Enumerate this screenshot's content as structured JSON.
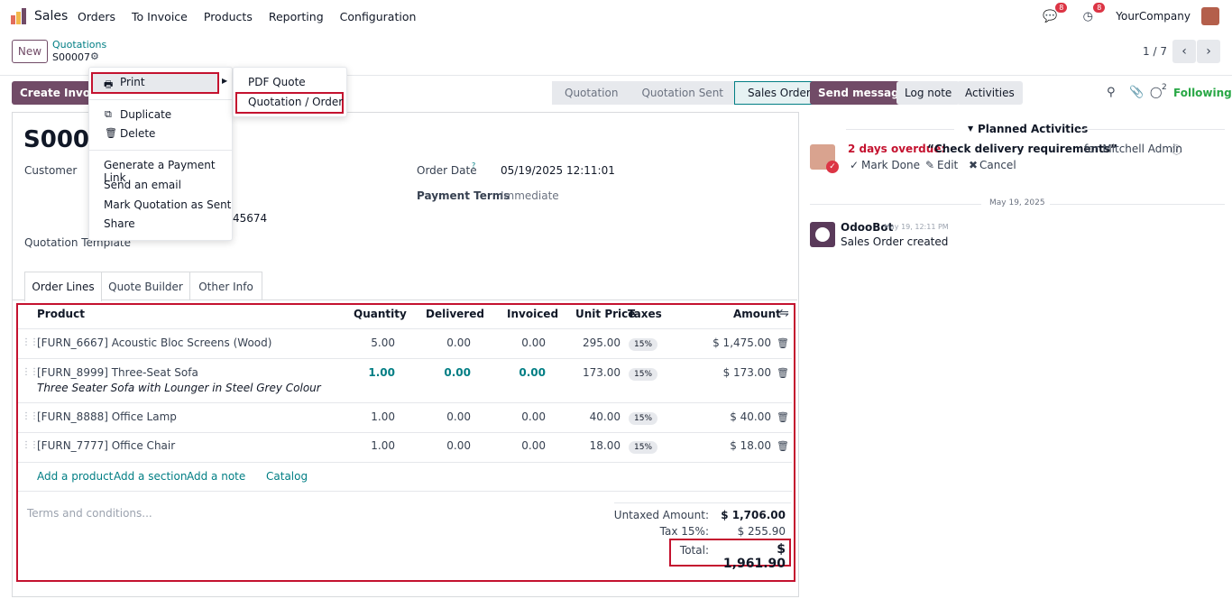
{
  "app": {
    "name": "Sales",
    "menu": [
      "Orders",
      "To Invoice",
      "Products",
      "Reporting",
      "Configuration"
    ],
    "company": "YourCompany",
    "messages_badge": "8",
    "activities_badge": "8"
  },
  "breadcrumb": {
    "new_label": "New",
    "parent": "Quotations",
    "record": "S00007",
    "pager": "1 / 7"
  },
  "actions": {
    "create_invoice": "Create Invoice"
  },
  "statusbar": [
    "Quotation",
    "Quotation Sent",
    "Sales Order"
  ],
  "form": {
    "title": "S0000",
    "customer_label": "Customer",
    "phone_fragment": "45674",
    "quotation_template_label": "Quotation Template",
    "order_date_label": "Order Date",
    "order_date_help": "?",
    "order_date": "05/19/2025 12:11:01",
    "payment_terms_label": "Payment Terms",
    "payment_terms": "Immediate"
  },
  "tabs": [
    "Order Lines",
    "Quote Builder",
    "Other Info"
  ],
  "table": {
    "headers": {
      "product": "Product",
      "quantity": "Quantity",
      "delivered": "Delivered",
      "invoiced": "Invoiced",
      "unit_price": "Unit Price",
      "taxes": "Taxes",
      "amount": "Amount"
    },
    "rows": [
      {
        "product": "[FURN_6667] Acoustic Bloc Screens (Wood)",
        "desc": "",
        "qty": "5.00",
        "delivered": "0.00",
        "invoiced": "0.00",
        "price": "295.00",
        "tax": "15%",
        "amount": "$ 1,475.00"
      },
      {
        "product": "[FURN_8999] Three-Seat Sofa",
        "desc": "Three Seater Sofa with Lounger in Steel Grey Colour",
        "qty": "1.00",
        "delivered": "0.00",
        "invoiced": "0.00",
        "price": "173.00",
        "tax": "15%",
        "amount": "$ 173.00"
      },
      {
        "product": "[FURN_8888] Office Lamp",
        "desc": "",
        "qty": "1.00",
        "delivered": "0.00",
        "invoiced": "0.00",
        "price": "40.00",
        "tax": "15%",
        "amount": "$ 40.00"
      },
      {
        "product": "[FURN_7777] Office Chair",
        "desc": "",
        "qty": "1.00",
        "delivered": "0.00",
        "invoiced": "0.00",
        "price": "18.00",
        "tax": "15%",
        "amount": "$ 18.00"
      }
    ],
    "add_links": [
      "Add a product",
      "Add a section",
      "Add a note",
      "Catalog"
    ]
  },
  "totals": {
    "terms_placeholder": "Terms and conditions...",
    "untaxed_label": "Untaxed Amount:",
    "untaxed": "$ 1,706.00",
    "tax_label": "Tax 15%:",
    "tax": "$ 255.90",
    "total_label": "Total:",
    "total": "$ 1,961.90"
  },
  "gear_menu": {
    "print": "Print",
    "duplicate": "Duplicate",
    "delete": "Delete",
    "payment_link": "Generate a Payment Link",
    "send_email": "Send an email",
    "mark_sent": "Mark Quotation as Sent",
    "share": "Share"
  },
  "print_submenu": [
    "PDF Quote",
    "Quotation / Order"
  ],
  "chatter": {
    "send_message": "Send message",
    "log_note": "Log note",
    "activities": "Activities",
    "followers_count": "2",
    "following": "Following",
    "planned_title": "Planned Activities",
    "overdue": "2 days overdue:",
    "activity_title": "“Check delivery requirements”",
    "activity_for": "for Mitchell Admin",
    "mark_done": "Mark Done",
    "edit": "Edit",
    "cancel": "Cancel",
    "date_sep": "May 19, 2025",
    "author": "OdooBot",
    "msg_time": "May 19, 12:11 PM",
    "msg_body": "Sales Order created"
  }
}
